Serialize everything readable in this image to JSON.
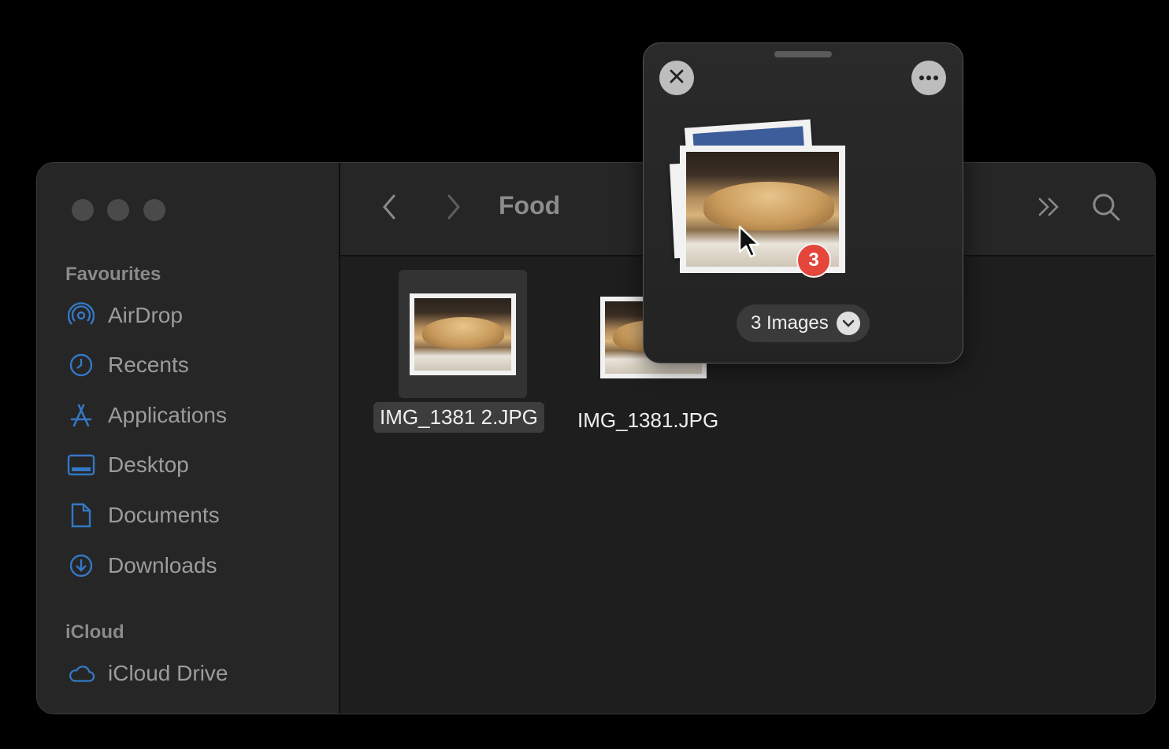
{
  "window": {
    "title": "Food"
  },
  "sidebar": {
    "sections": [
      {
        "title": "Favourites",
        "items": [
          {
            "label": "AirDrop",
            "icon": "airdrop-icon"
          },
          {
            "label": "Recents",
            "icon": "clock-icon"
          },
          {
            "label": "Applications",
            "icon": "applications-icon"
          },
          {
            "label": "Desktop",
            "icon": "desktop-icon"
          },
          {
            "label": "Documents",
            "icon": "document-icon"
          },
          {
            "label": "Downloads",
            "icon": "download-icon"
          }
        ]
      },
      {
        "title": "iCloud",
        "items": [
          {
            "label": "iCloud Drive",
            "icon": "cloud-icon"
          }
        ]
      }
    ]
  },
  "files": [
    {
      "name": "IMG_1381 2.JPG",
      "selected": true
    },
    {
      "name": "IMG_1381.JPG",
      "selected": false
    }
  ],
  "drag_popover": {
    "badge_count": "3",
    "count_label": "3 Images"
  },
  "colors": {
    "sidebar_icon": "#3478c5",
    "badge": "#e5463b",
    "window_bg": "#1e1e1e"
  }
}
